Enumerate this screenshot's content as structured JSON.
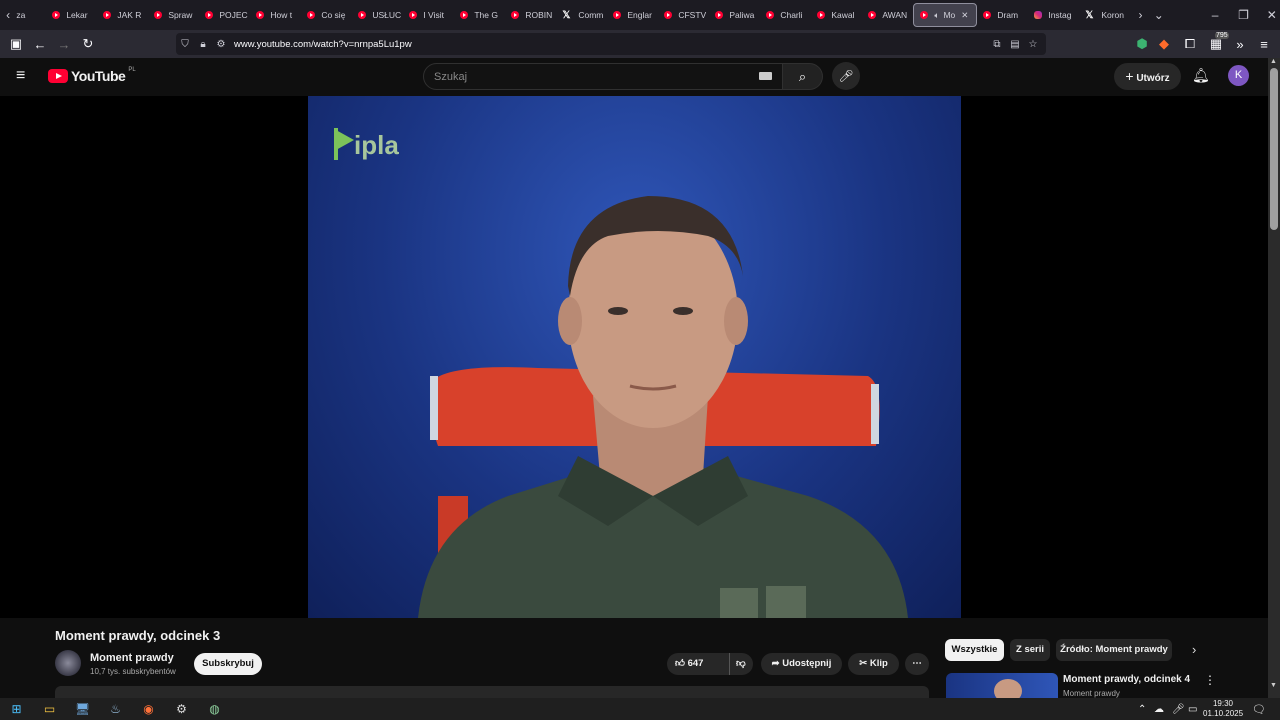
{
  "browser": {
    "tabs": [
      {
        "label": "za",
        "icon": "chevron-left-icon"
      },
      {
        "label": "Lekar",
        "icon": "youtube-icon"
      },
      {
        "label": "JAK R",
        "icon": "youtube-icon"
      },
      {
        "label": "Spraw",
        "icon": "youtube-icon"
      },
      {
        "label": "POJEC",
        "icon": "youtube-icon"
      },
      {
        "label": "How t",
        "icon": "youtube-icon"
      },
      {
        "label": "Co się",
        "icon": "youtube-icon"
      },
      {
        "label": "USŁUC",
        "icon": "youtube-icon"
      },
      {
        "label": "I Visit",
        "icon": "youtube-icon"
      },
      {
        "label": "The G",
        "icon": "youtube-icon"
      },
      {
        "label": "ROBIN",
        "icon": "youtube-icon"
      },
      {
        "label": "Comm",
        "icon": "x-icon"
      },
      {
        "label": "Englar",
        "icon": "youtube-icon"
      },
      {
        "label": "CFSTV",
        "icon": "youtube-icon"
      },
      {
        "label": "Paliwa",
        "icon": "youtube-icon"
      },
      {
        "label": "Charli",
        "icon": "youtube-icon"
      },
      {
        "label": "Kawal",
        "icon": "youtube-icon"
      },
      {
        "label": "AWAN",
        "icon": "youtube-icon"
      },
      {
        "label": "Mo",
        "icon": "youtube-icon",
        "active": true
      },
      {
        "label": "Dram",
        "icon": "youtube-icon"
      },
      {
        "label": "Instag",
        "icon": "instagram-icon"
      },
      {
        "label": "Koron",
        "icon": "x-icon"
      }
    ],
    "url": "www.youtube.com/watch?v=nrnpa5Lu1pw",
    "extension_badge": "795"
  },
  "youtube": {
    "logo_text": "YouTube",
    "region": "PL",
    "search_placeholder": "Szukaj",
    "create_label": "Utwórz",
    "avatar_letter": "K",
    "video_watermark": "ipla"
  },
  "video": {
    "title": "Moment prawdy, odcinek 3",
    "channel_name": "Moment prawdy",
    "subscribers": "10,7 tys. subskrybentów",
    "subscribe_label": "Subskrybuj",
    "likes": "647",
    "share_label": "Udostępnij",
    "clip_label": "Klip"
  },
  "chips": [
    "Wszystkie",
    "Z serii",
    "Źródło: Moment prawdy"
  ],
  "recommendation": {
    "title": "Moment prawdy, odcinek 4",
    "channel": "Moment prawdy"
  },
  "taskbar": {
    "time": "19:30",
    "date": "01.10.2025"
  }
}
